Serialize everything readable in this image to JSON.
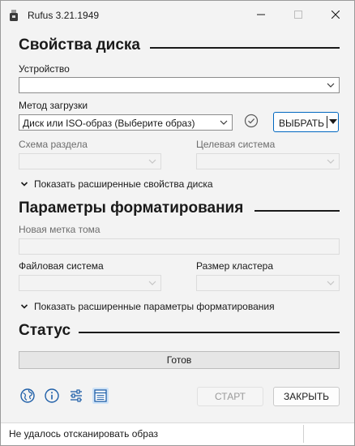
{
  "window": {
    "title": "Rufus 3.21.1949"
  },
  "drive_properties": {
    "heading": "Свойства диска",
    "device_label": "Устройство",
    "device_value": "",
    "boot_selection_label": "Метод загрузки",
    "boot_selection_value": "Диск или ISO-образ (Выберите образ)",
    "select_button_label": "ВЫБРАТЬ",
    "partition_scheme_label": "Схема раздела",
    "target_system_label": "Целевая система",
    "advanced_toggle_label": "Показать расширенные свойства диска"
  },
  "format_options": {
    "heading": "Параметры форматирования",
    "volume_label_label": "Новая метка тома",
    "file_system_label": "Файловая система",
    "cluster_size_label": "Размер кластера",
    "advanced_toggle_label": "Показать расширенные параметры форматирования"
  },
  "status": {
    "heading": "Статус",
    "progress_text": "Готов"
  },
  "toolbar": {
    "icons": [
      "globe-icon",
      "info-icon",
      "settings-sliders-icon",
      "log-icon"
    ],
    "start_label": "СТАРТ",
    "close_label": "ЗАКРЫТЬ"
  },
  "footer": {
    "message": "Не удалось отсканировать образ"
  },
  "colors": {
    "accent": "#0067c0",
    "window_bg": "#f3f3f3",
    "icon_blue": "#1f5fa8"
  }
}
